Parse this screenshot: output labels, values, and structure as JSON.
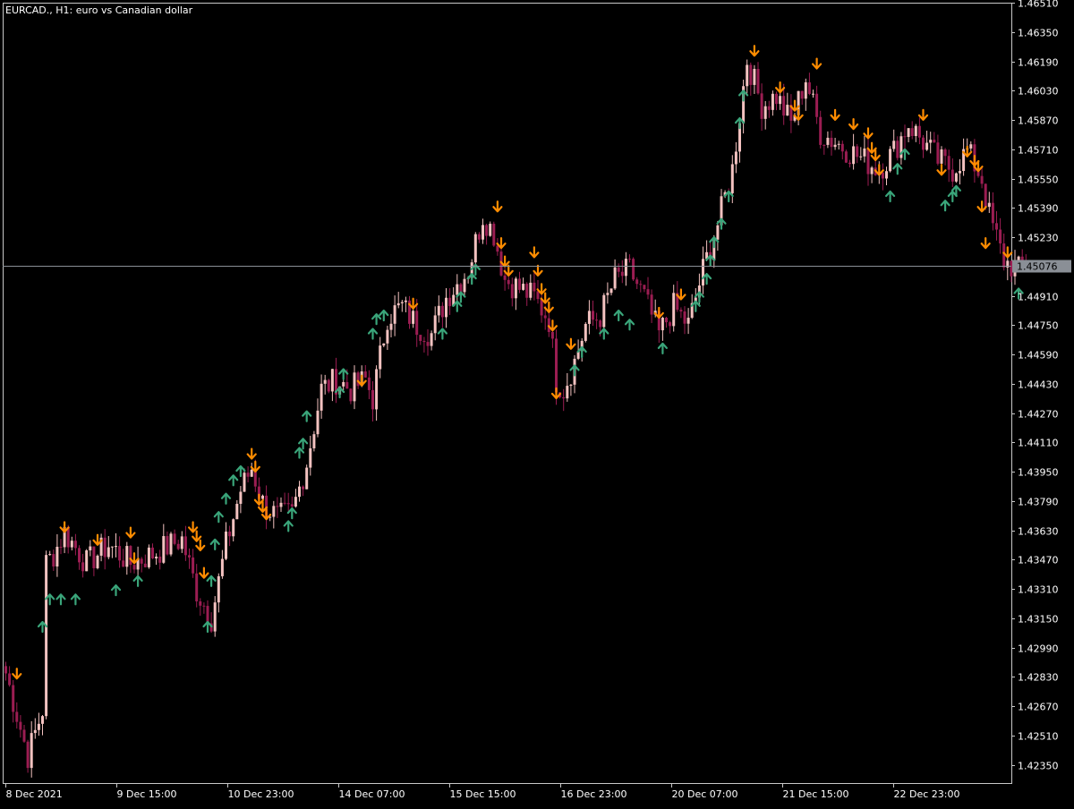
{
  "header": {
    "symbol_line": "EURCAD., H1:  euro vs Canadian dollar"
  },
  "colors": {
    "background": "#000000",
    "frame": "#c8c8c8",
    "text": "#ffffff",
    "bull_candle": "#f3c2c0",
    "bear_candle": "#9b1d52",
    "up_arrow": "#3aa57a",
    "down_arrow": "#ff8c00",
    "current_price_line": "#8a8f96",
    "current_price_label_bg": "#8a8f96",
    "current_price_label_text": "#000000"
  },
  "chart_data": {
    "type": "candlestick",
    "title": "EURCAD., H1:  euro vs Canadian dollar",
    "ylim": [
      1.4225,
      1.4651
    ],
    "y_ticks": [
      "1.42350",
      "1.42510",
      "1.42670",
      "1.42830",
      "1.42990",
      "1.43150",
      "1.43310",
      "1.43470",
      "1.43630",
      "1.43790",
      "1.43950",
      "1.44110",
      "1.44270",
      "1.44430",
      "1.44590",
      "1.44750",
      "1.44910",
      "1.45076",
      "1.45230",
      "1.45390",
      "1.45550",
      "1.45710",
      "1.45870",
      "1.46030",
      "1.46190",
      "1.46350",
      "1.46510"
    ],
    "x_ticks": [
      "8 Dec 2021",
      "9 Dec 15:00",
      "10 Dec 23:00",
      "14 Dec 07:00",
      "15 Dec 15:00",
      "16 Dec 23:00",
      "20 Dec 07:00",
      "21 Dec 15:00",
      "22 Dec 23:00"
    ],
    "current_price": "1.45076",
    "close_anchors": [
      [
        0,
        1.4285
      ],
      [
        6,
        1.424
      ],
      [
        10,
        1.4265
      ],
      [
        11,
        1.4345
      ],
      [
        13,
        1.435
      ],
      [
        16,
        1.4362
      ],
      [
        22,
        1.4345
      ],
      [
        28,
        1.4355
      ],
      [
        34,
        1.4345
      ],
      [
        40,
        1.435
      ],
      [
        48,
        1.4358
      ],
      [
        52,
        1.433
      ],
      [
        56,
        1.4315
      ],
      [
        60,
        1.4355
      ],
      [
        64,
        1.4385
      ],
      [
        67,
        1.4397
      ],
      [
        70,
        1.4378
      ],
      [
        74,
        1.437
      ],
      [
        78,
        1.4372
      ],
      [
        82,
        1.44
      ],
      [
        86,
        1.444
      ],
      [
        90,
        1.4445
      ],
      [
        94,
        1.444
      ],
      [
        98,
        1.4445
      ],
      [
        100,
        1.4435
      ],
      [
        104,
        1.448
      ],
      [
        108,
        1.4485
      ],
      [
        112,
        1.4475
      ],
      [
        116,
        1.447
      ],
      [
        120,
        1.449
      ],
      [
        126,
        1.4505
      ],
      [
        130,
        1.4535
      ],
      [
        133,
        1.4525
      ],
      [
        136,
        1.45
      ],
      [
        140,
        1.4495
      ],
      [
        144,
        1.449
      ],
      [
        148,
        1.4478
      ],
      [
        150,
        1.4445
      ],
      [
        152,
        1.444
      ],
      [
        155,
        1.4455
      ],
      [
        158,
        1.4475
      ],
      [
        162,
        1.448
      ],
      [
        166,
        1.45
      ],
      [
        170,
        1.4505
      ],
      [
        174,
        1.449
      ],
      [
        178,
        1.447
      ],
      [
        182,
        1.4485
      ],
      [
        186,
        1.4475
      ],
      [
        190,
        1.4505
      ],
      [
        194,
        1.453
      ],
      [
        198,
        1.456
      ],
      [
        200,
        1.459
      ],
      [
        202,
        1.462
      ],
      [
        206,
        1.4595
      ],
      [
        210,
        1.46
      ],
      [
        214,
        1.4585
      ],
      [
        218,
        1.461
      ],
      [
        222,
        1.458
      ],
      [
        226,
        1.4575
      ],
      [
        230,
        1.457
      ],
      [
        234,
        1.4565
      ],
      [
        238,
        1.456
      ],
      [
        242,
        1.457
      ],
      [
        246,
        1.4585
      ],
      [
        250,
        1.4575
      ],
      [
        254,
        1.4565
      ],
      [
        258,
        1.456
      ],
      [
        262,
        1.457
      ],
      [
        266,
        1.4555
      ],
      [
        268,
        1.4535
      ],
      [
        272,
        1.451
      ],
      [
        276,
        1.4505
      ],
      [
        278,
        1.451
      ]
    ],
    "up_signals": [
      [
        10,
        1.431
      ],
      [
        12,
        1.4325
      ],
      [
        15,
        1.4325
      ],
      [
        19,
        1.4325
      ],
      [
        30,
        1.433
      ],
      [
        36,
        1.4335
      ],
      [
        55,
        1.431
      ],
      [
        56,
        1.4335
      ],
      [
        57,
        1.4355
      ],
      [
        58,
        1.437
      ],
      [
        60,
        1.438
      ],
      [
        62,
        1.439
      ],
      [
        64,
        1.4395
      ],
      [
        77,
        1.4365
      ],
      [
        78,
        1.4372
      ],
      [
        80,
        1.4405
      ],
      [
        81,
        1.441
      ],
      [
        82,
        1.4425
      ],
      [
        91,
        1.4438
      ],
      [
        92,
        1.4448
      ],
      [
        100,
        1.447
      ],
      [
        101,
        1.4478
      ],
      [
        103,
        1.448
      ],
      [
        119,
        1.447
      ],
      [
        123,
        1.4485
      ],
      [
        124,
        1.449
      ],
      [
        127,
        1.45
      ],
      [
        128,
        1.4505
      ],
      [
        155,
        1.445
      ],
      [
        157,
        1.446
      ],
      [
        163,
        1.447
      ],
      [
        167,
        1.448
      ],
      [
        170,
        1.4475
      ],
      [
        179,
        1.4462
      ],
      [
        188,
        1.4485
      ],
      [
        189,
        1.449
      ],
      [
        191,
        1.45
      ],
      [
        192,
        1.451
      ],
      [
        193,
        1.452
      ],
      [
        195,
        1.453
      ],
      [
        197,
        1.4545
      ],
      [
        200,
        1.4585
      ],
      [
        201,
        1.46
      ],
      [
        241,
        1.4545
      ],
      [
        243,
        1.456
      ],
      [
        245,
        1.4568
      ],
      [
        256,
        1.454
      ],
      [
        258,
        1.4545
      ],
      [
        259,
        1.4548
      ],
      [
        276,
        1.4492
      ]
    ],
    "down_signals": [
      [
        3,
        1.4285
      ],
      [
        16,
        1.4365
      ],
      [
        25,
        1.4358
      ],
      [
        34,
        1.4362
      ],
      [
        35,
        1.4348
      ],
      [
        51,
        1.4365
      ],
      [
        52,
        1.436
      ],
      [
        53,
        1.4355
      ],
      [
        54,
        1.434
      ],
      [
        67,
        1.4405
      ],
      [
        68,
        1.4398
      ],
      [
        69,
        1.438
      ],
      [
        70,
        1.4376
      ],
      [
        71,
        1.4372
      ],
      [
        97,
        1.4445
      ],
      [
        111,
        1.4487
      ],
      [
        134,
        1.454
      ],
      [
        135,
        1.452
      ],
      [
        136,
        1.451
      ],
      [
        137,
        1.4505
      ],
      [
        144,
        1.4515
      ],
      [
        145,
        1.4505
      ],
      [
        146,
        1.4495
      ],
      [
        147,
        1.449
      ],
      [
        148,
        1.4485
      ],
      [
        149,
        1.4475
      ],
      [
        150,
        1.4438
      ],
      [
        154,
        1.4465
      ],
      [
        178,
        1.4482
      ],
      [
        184,
        1.4492
      ],
      [
        204,
        1.4625
      ],
      [
        211,
        1.4605
      ],
      [
        215,
        1.4595
      ],
      [
        216,
        1.459
      ],
      [
        221,
        1.4618
      ],
      [
        226,
        1.459
      ],
      [
        231,
        1.4585
      ],
      [
        235,
        1.458
      ],
      [
        236,
        1.4572
      ],
      [
        237,
        1.4568
      ],
      [
        238,
        1.456
      ],
      [
        250,
        1.459
      ],
      [
        255,
        1.456
      ],
      [
        262,
        1.457
      ],
      [
        264,
        1.4565
      ],
      [
        265,
        1.4562
      ],
      [
        266,
        1.454
      ],
      [
        267,
        1.452
      ],
      [
        273,
        1.4515
      ]
    ]
  }
}
